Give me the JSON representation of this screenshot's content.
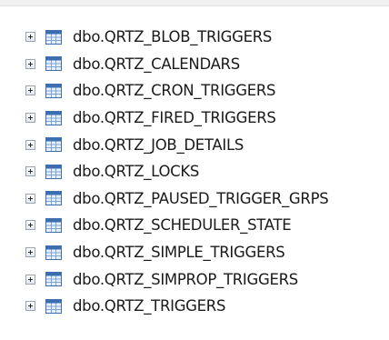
{
  "tree": {
    "items": [
      {
        "label": "dbo.QRTZ_BLOB_TRIGGERS"
      },
      {
        "label": "dbo.QRTZ_CALENDARS"
      },
      {
        "label": "dbo.QRTZ_CRON_TRIGGERS"
      },
      {
        "label": "dbo.QRTZ_FIRED_TRIGGERS"
      },
      {
        "label": "dbo.QRTZ_JOB_DETAILS"
      },
      {
        "label": "dbo.QRTZ_LOCKS"
      },
      {
        "label": "dbo.QRTZ_PAUSED_TRIGGER_GRPS"
      },
      {
        "label": "dbo.QRTZ_SCHEDULER_STATE"
      },
      {
        "label": "dbo.QRTZ_SIMPLE_TRIGGERS"
      },
      {
        "label": "dbo.QRTZ_SIMPROP_TRIGGERS"
      },
      {
        "label": "dbo.QRTZ_TRIGGERS"
      }
    ],
    "expander_icon": "plus-expander-icon",
    "node_icon": "table-icon"
  },
  "colors": {
    "icon_header": "#3d6fb0",
    "icon_grid": "#7fa3d3",
    "icon_cell": "#e8f0fb",
    "text": "#1a1a1a"
  }
}
